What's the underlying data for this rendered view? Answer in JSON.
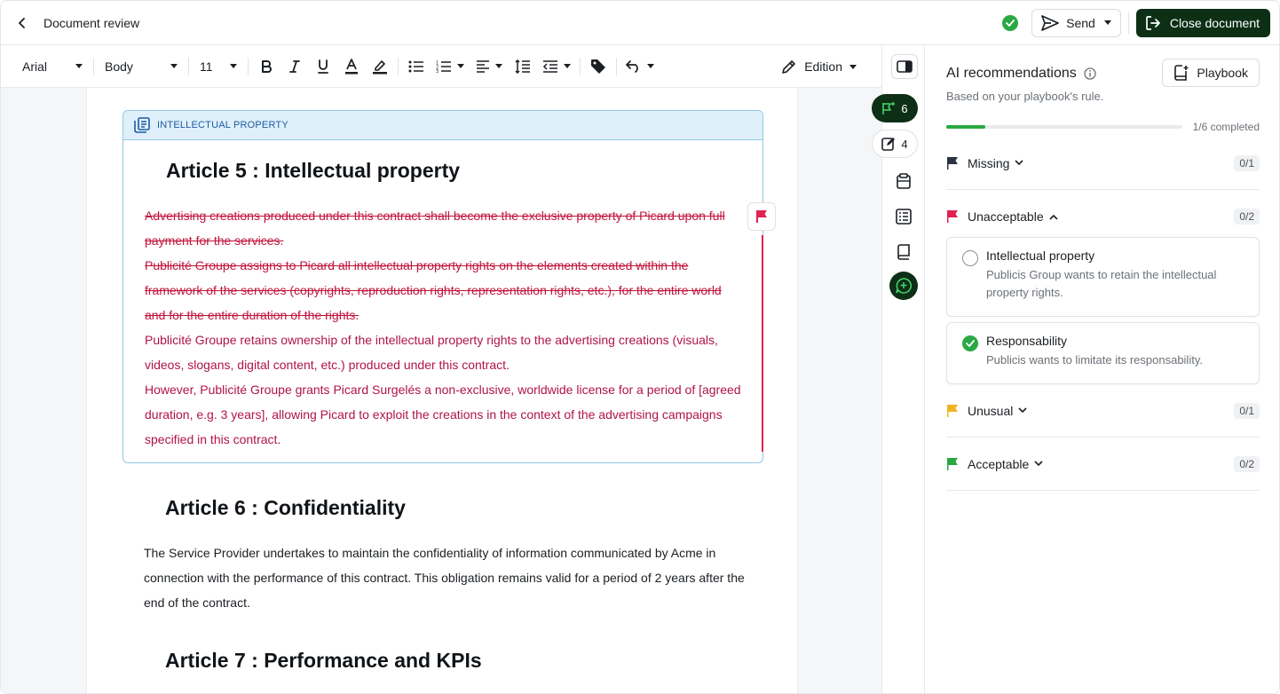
{
  "header": {
    "title": "Document review",
    "send_label": "Send",
    "close_label": "Close document"
  },
  "toolbar": {
    "font": "Arial",
    "style": "Body",
    "size": "11",
    "edition_label": "Edition"
  },
  "document": {
    "clause_tag": "INTELLECTUAL PROPERTY",
    "article5": {
      "title": "Article 5 : Intellectual property",
      "struck1": "Advertising creations produced under this contract shall become the exclusive property of Picard upon full payment for the services.",
      "struck2": "Publicité Groupe assigns to Picard all intellectual property rights on the elements created within the framework of the services (copyrights, reproduction rights, representation rights, etc.), for the entire world and for the entire duration of the rights.",
      "inserted1": "Publicité Groupe retains ownership of the intellectual property rights to the advertising creations (visuals, videos, slogans, digital content, etc.) produced under this contract.",
      "inserted2": "However, Publicité Groupe grants Picard Surgelés a non-exclusive, worldwide license for a period of [agreed duration, e.g. 3 years], allowing Picard to exploit the creations in the context of the advertising campaigns specified in this contract."
    },
    "article6": {
      "title": "Article 6 : Confidentiality",
      "body": "The Service Provider undertakes to maintain the confidentiality of information communicated by Acme in connection with the performance of this contract. This obligation remains valid for a period of 2 years after the end of the contract."
    },
    "article7": {
      "title": "Article 7 : Performance and KPIs"
    }
  },
  "rail": {
    "flags_count": "6",
    "edits_count": "4"
  },
  "panel": {
    "title": "AI recommendations",
    "subtitle": "Based on your playbook's rule.",
    "playbook_label": "Playbook",
    "progress": 0.167,
    "progress_label": "1/6 completed",
    "sections": [
      {
        "label": "Missing",
        "count": "0/1",
        "color": "#2b3440"
      },
      {
        "label": "Unacceptable",
        "count": "0/2",
        "color": "#e3204f"
      },
      {
        "label": "Unusual",
        "count": "0/1",
        "color": "#f0b323"
      },
      {
        "label": "Acceptable",
        "count": "0/2",
        "color": "#2aa844"
      }
    ],
    "cards": [
      {
        "title": "Intellectual property",
        "desc": "Publicis Group wants to retain the intellectual property rights.",
        "done": false
      },
      {
        "title": "Responsability",
        "desc": "Publicis wants to limitate its responsability.",
        "done": true
      }
    ]
  }
}
